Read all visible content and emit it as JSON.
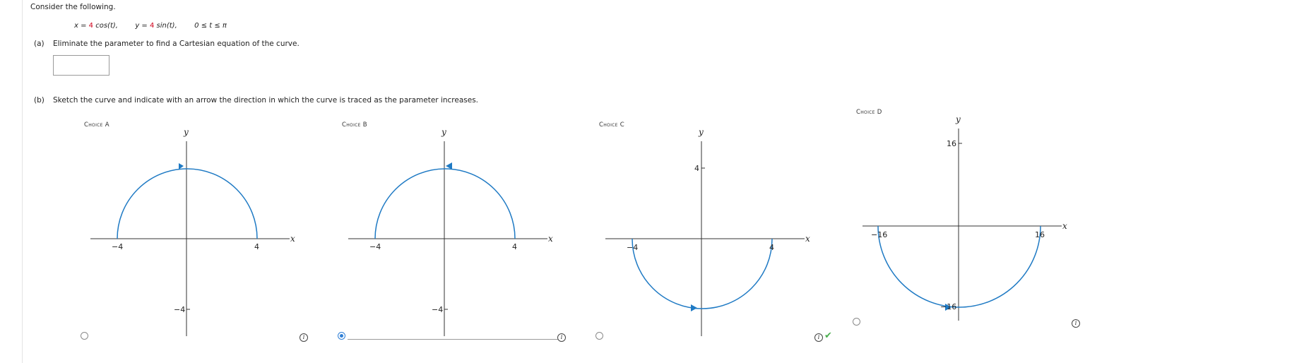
{
  "question": {
    "intro": "Consider the following.",
    "equations": {
      "x_prefix": "x = ",
      "x_coef": "4",
      "x_suffix": " cos(t),",
      "y_prefix": "y = ",
      "y_coef": "4",
      "y_suffix": " sin(t),",
      "domain": "0 ≤ t ≤ π"
    },
    "part_a": {
      "tag": "(a)",
      "text": "Eliminate the parameter to find a Cartesian equation of the curve.",
      "answer_value": ""
    },
    "part_b": {
      "tag": "(b)",
      "text": "Sketch the curve and indicate with an arrow the direction in which the curve is traced as the parameter increases."
    }
  },
  "choices": [
    {
      "label": "Choice A",
      "selected": false,
      "ticks": {
        "x_neg": "−4",
        "x_pos": "4",
        "y_val": "−4"
      },
      "x_axis": "x",
      "y_axis": "y",
      "info_icon": "info-icon",
      "correct": false
    },
    {
      "label": "Choice B",
      "selected": true,
      "ticks": {
        "x_neg": "−4",
        "x_pos": "4",
        "y_val": "−4"
      },
      "x_axis": "x",
      "y_axis": "y",
      "info_icon": "info-icon",
      "correct": false
    },
    {
      "label": "Choice C",
      "selected": false,
      "ticks": {
        "x_neg": "−4",
        "x_pos": "4",
        "y_val": "4"
      },
      "x_axis": "x",
      "y_axis": "y",
      "info_icon": "info-icon",
      "correct": true,
      "check_icon": "check-icon"
    },
    {
      "label": "Choice D",
      "selected": false,
      "ticks": {
        "x_neg": "−16",
        "x_pos": "16",
        "y_val": "16",
        "y_bottom": "−16"
      },
      "x_axis": "x",
      "y_axis": "y",
      "info_icon": "info-icon",
      "correct": false
    }
  ],
  "colors": {
    "curve": "#1f7ac4",
    "accent": "#2f7fd6",
    "correct": "#4caf50",
    "highlight": "#d0021b"
  }
}
